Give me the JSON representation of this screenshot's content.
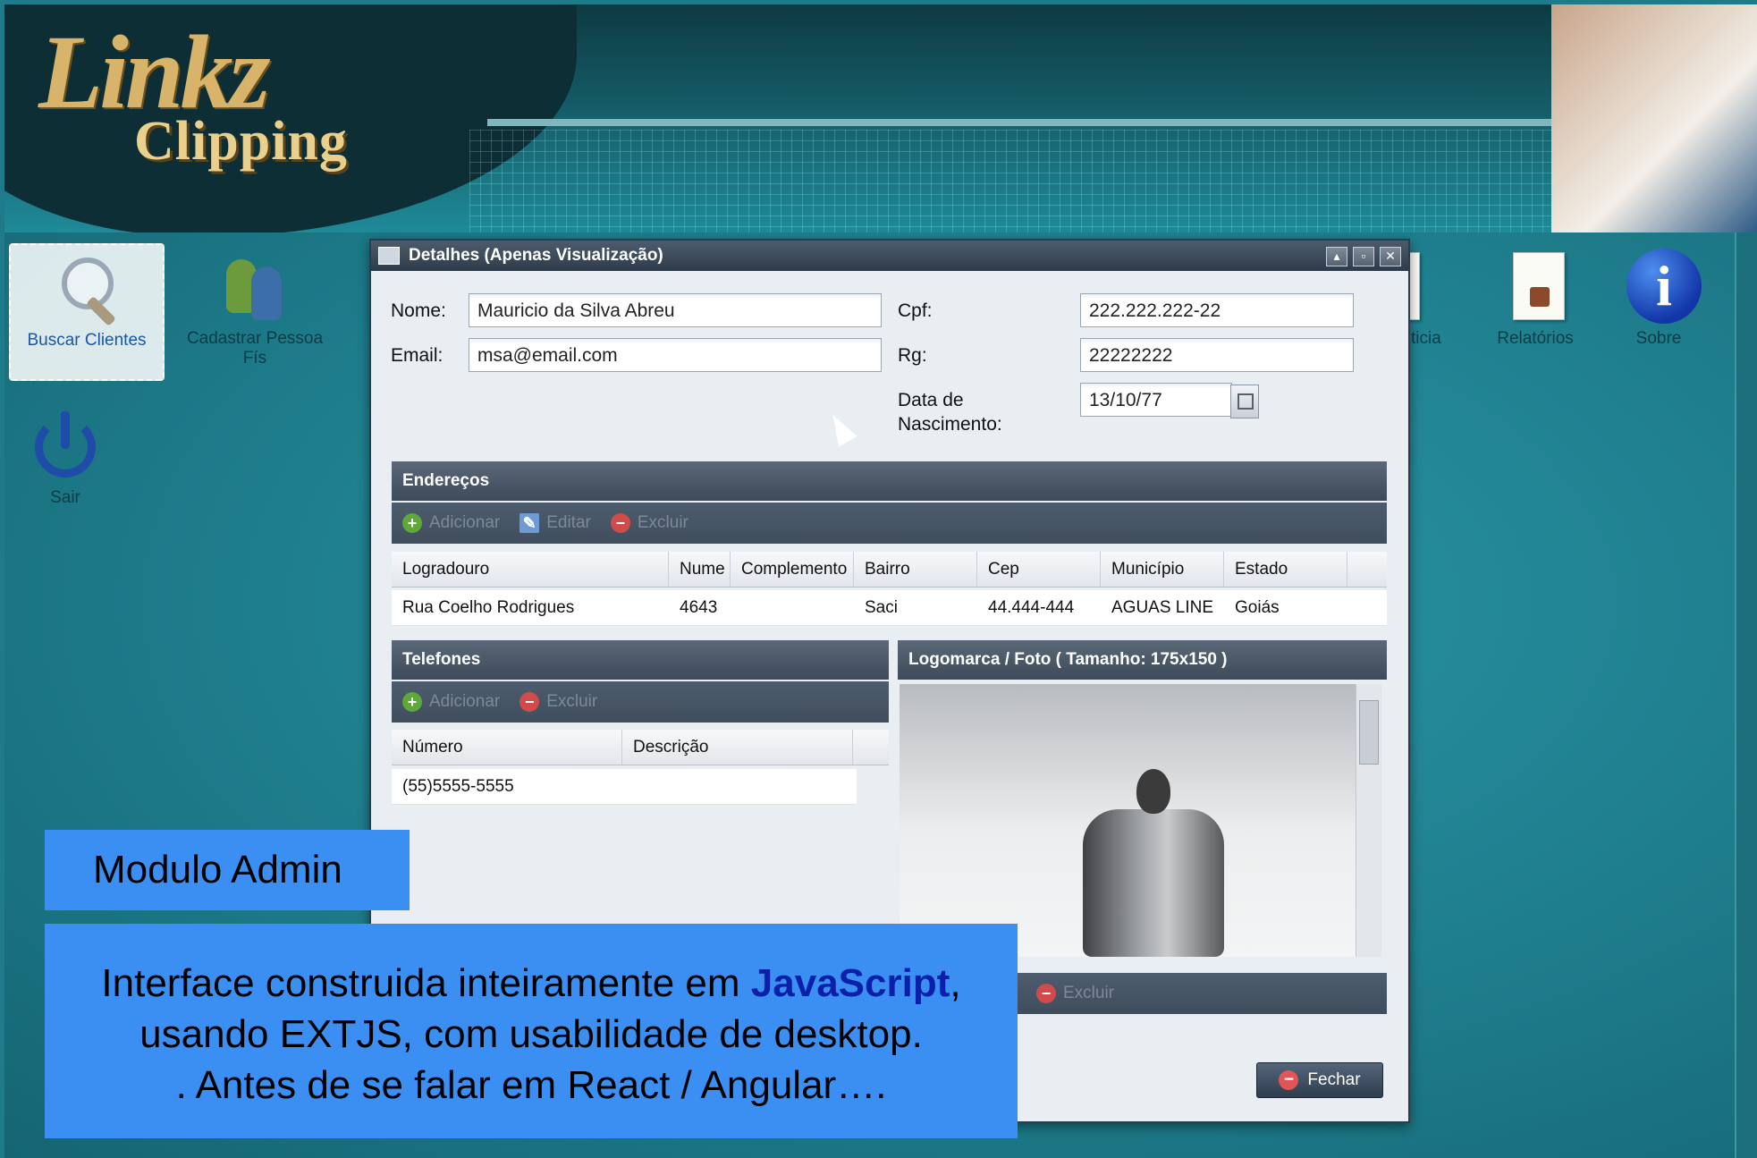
{
  "brand": {
    "word1": "Linkz",
    "word2": "Clipping"
  },
  "desktop_icons": {
    "buscar": "Buscar Clientes",
    "cadastrar": "Cadastrar Pessoa Fís",
    "sair": "Sair",
    "noticia": "ticia",
    "relatorios": "Relatórios",
    "sobre": "Sobre"
  },
  "window": {
    "title": "Detalhes (Apenas Visualização)",
    "fields": {
      "nome_label": "Nome:",
      "nome_value": "Mauricio da Silva Abreu",
      "email_label": "Email:",
      "email_value": "msa@email.com",
      "cpf_label": "Cpf:",
      "cpf_value": "222.222.222-22",
      "rg_label": "Rg:",
      "rg_value": "22222222",
      "nasc_label_1": "Data de",
      "nasc_label_2": "Nascimento:",
      "nasc_value": "13/10/77"
    },
    "enderecos": {
      "title": "Endereços",
      "toolbar": {
        "add": "Adicionar",
        "edit": "Editar",
        "delete": "Excluir"
      },
      "columns": [
        "Logradouro",
        "Nume",
        "Complemento",
        "Bairro",
        "Cep",
        "Município",
        "Estado"
      ],
      "rows": [
        [
          "Rua Coelho Rodrigues",
          "4643",
          "",
          "Saci",
          "44.444-444",
          "AGUAS LINE",
          "Goiás"
        ]
      ]
    },
    "telefones": {
      "title": "Telefones",
      "toolbar": {
        "add": "Adicionar",
        "delete": "Excluir"
      },
      "columns": [
        "Número",
        "Descrição"
      ],
      "rows": [
        [
          "(55)5555-5555",
          ""
        ]
      ]
    },
    "foto": {
      "title": "Logomarca / Foto ( Tamanho: 175x150 )",
      "delete": "Excluir"
    },
    "close_button": "Fechar"
  },
  "overlay": {
    "module": "Modulo Admin",
    "line1_pre": "Interface construida inteiramente em ",
    "line1_hl": "JavaScript",
    "line1_post": ",",
    "line2": "usando EXTJS, com usabilidade de desktop.",
    "line3": ". Antes de se falar em React / Angular…."
  },
  "colors": {
    "overlay_bg": "#3c8ff2",
    "highlight": "#0c1fa8",
    "window_header": "#3c4a5a"
  }
}
